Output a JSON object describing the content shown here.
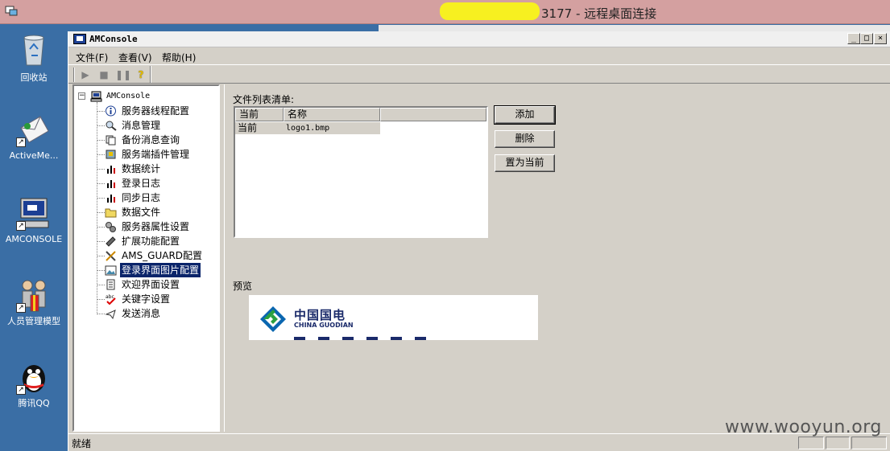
{
  "rdp": {
    "title": "3177 - 远程桌面连接"
  },
  "desktop": {
    "icons": [
      {
        "label": "回收站",
        "icon": "recycle-bin-icon"
      },
      {
        "label": "ActiveMe...",
        "icon": "activemessenger-icon"
      },
      {
        "label": "AMCONSOLE",
        "icon": "computer-icon"
      },
      {
        "label": "人员管理模型",
        "icon": "people-icon"
      },
      {
        "label": "腾讯QQ",
        "icon": "qq-penguin-icon"
      }
    ]
  },
  "app": {
    "title": "AMConsole",
    "menu": [
      "文件(F)",
      "查看(V)",
      "帮助(H)"
    ],
    "toolbar": [
      "play-icon",
      "stop-icon",
      "pause-icon",
      "help-icon"
    ]
  },
  "tree": {
    "root": "AMConsole",
    "items": [
      {
        "label": "服务器线程配置",
        "icon": "info-icon"
      },
      {
        "label": "消息管理",
        "icon": "magnifier-icon"
      },
      {
        "label": "备份消息查询",
        "icon": "copy-icon"
      },
      {
        "label": "服务端插件管理",
        "icon": "plugin-icon"
      },
      {
        "label": "数据统计",
        "icon": "bar-chart-icon"
      },
      {
        "label": "登录日志",
        "icon": "bar-chart-icon"
      },
      {
        "label": "同步日志",
        "icon": "bar-chart-icon"
      },
      {
        "label": "数据文件",
        "icon": "folder-icon"
      },
      {
        "label": "服务器属性设置",
        "icon": "gears-icon"
      },
      {
        "label": "扩展功能配置",
        "icon": "tools-icon"
      },
      {
        "label": "AMS_GUARD配置",
        "icon": "crossed-tools-icon"
      },
      {
        "label": "登录界面图片配置",
        "icon": "picture-icon"
      },
      {
        "label": "欢迎界面设置",
        "icon": "document-icon"
      },
      {
        "label": "关键字设置",
        "icon": "spellcheck-icon"
      },
      {
        "label": "发送消息",
        "icon": "send-icon"
      }
    ],
    "selected_index": 11
  },
  "panel": {
    "file_list_label": "文件列表清单:",
    "columns": [
      "当前",
      "名称"
    ],
    "rows": [
      {
        "current": "当前",
        "name": "logo1.bmp"
      }
    ],
    "buttons": {
      "add": "添加",
      "delete": "删除",
      "set_current": "置为当前"
    },
    "preview_label": "预览",
    "preview_logo": {
      "cn": "中国国电",
      "en": "CHINA GUODIAN"
    }
  },
  "status": {
    "text": "就绪"
  },
  "watermark": "www.wooyun.org",
  "colors": {
    "desktop": "#3a6ea5",
    "selection": "#0a246a",
    "face": "#d4d0c8",
    "redaction": "#f7f020"
  }
}
